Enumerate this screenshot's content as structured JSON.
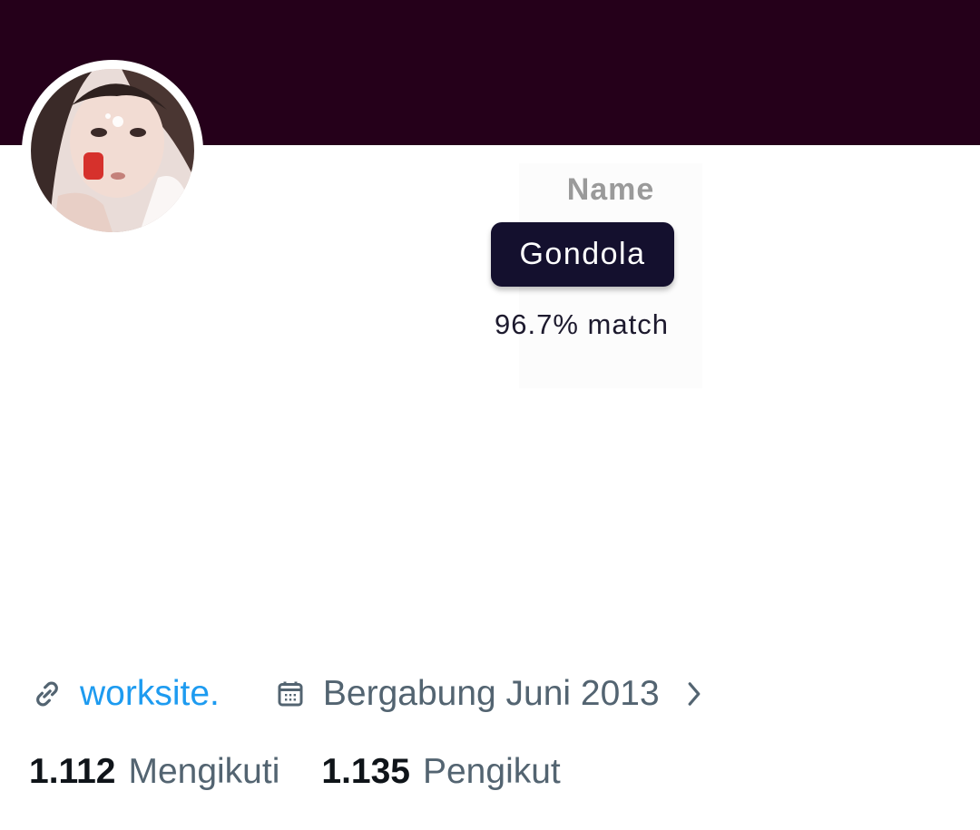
{
  "profile": {
    "name_label": "Name",
    "name_value": "Gondola",
    "match_text": "96.7% match"
  },
  "meta": {
    "link_icon": "link-icon",
    "website": "worksite.",
    "calendar_icon": "calendar-icon",
    "joined": "Bergabung Juni 2013",
    "chevron_icon": "chevron-right-icon"
  },
  "stats": {
    "following_count": "1.112",
    "following_label": "Mengikuti",
    "followers_count": "1.135",
    "followers_label": "Pengikut"
  },
  "colors": {
    "banner": "#25001a",
    "chip": "#14102e",
    "link": "#1d9bf0",
    "secondary_text": "#536471"
  }
}
